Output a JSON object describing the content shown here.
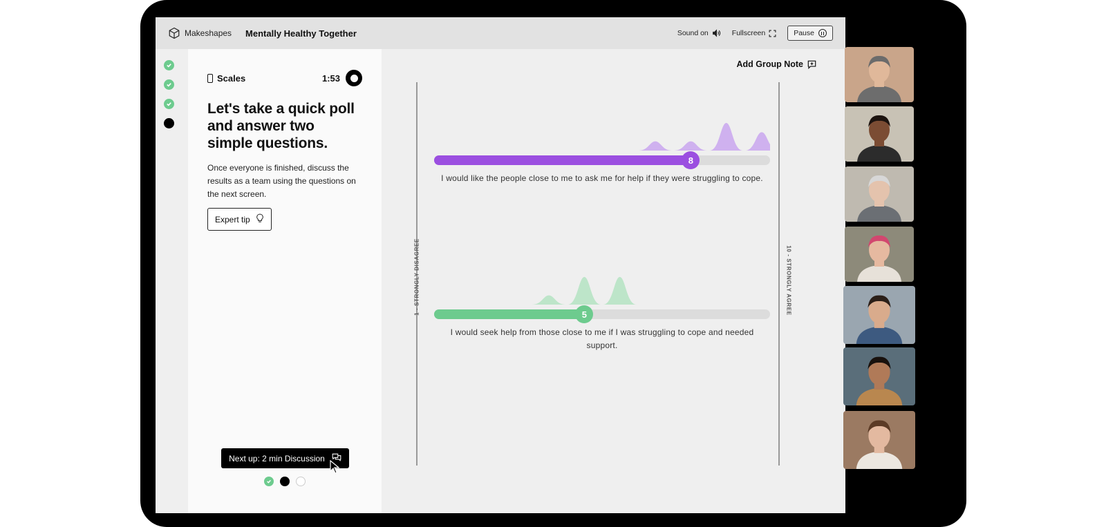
{
  "topbar": {
    "logo_text": "Makeshapes",
    "title": "Mentally Healthy Together",
    "sound_label": "Sound on",
    "fullscreen_label": "Fullscreen",
    "pause_label": "Pause"
  },
  "left_panel": {
    "activity_label": "Scales",
    "timer": "1:53",
    "heading": "Let's take a quick poll and answer two simple questions.",
    "description": "Once everyone is finished, discuss the results as a team using the questions on the next screen.",
    "expert_tip_label": "Expert tip",
    "next_up_label": "Next up: 2 min Discussion",
    "pager": [
      "done",
      "current",
      "empty"
    ]
  },
  "steps": [
    "done",
    "done",
    "done",
    "current"
  ],
  "main": {
    "add_note_label": "Add Group Note",
    "left_axis_label": "1 - STRONGLY DISAGREE",
    "right_axis_label": "10 - STRONGLY AGREE",
    "scale_min": 1,
    "scale_max": 10,
    "questions": [
      {
        "text": "I would like the people close to me to ask me for help if they were struggling to cope.",
        "value": 8,
        "value_label": "8",
        "color": "#9b4fe0",
        "dist_color": "#c9a6ee",
        "distribution": [
          0,
          0,
          0,
          0,
          0,
          0,
          1,
          1,
          3,
          2
        ]
      },
      {
        "text": "I would seek help from those close to me if I was struggling to cope and needed support.",
        "value": 5,
        "value_label": "5",
        "color": "#6dcb8e",
        "dist_color": "#b4e3c2",
        "distribution": [
          0,
          0,
          0,
          1,
          3,
          3,
          0,
          0,
          0,
          0
        ]
      }
    ]
  },
  "participants": [
    {
      "name": "participant-1",
      "bg": "#c9a58a",
      "skin": "#e0b89a",
      "hair": "#6b6b6b",
      "shirt": "#6d6d6d"
    },
    {
      "name": "participant-2",
      "bg": "#c8c2b5",
      "skin": "#7b4c33",
      "hair": "#1c130f",
      "shirt": "#2c2c2c"
    },
    {
      "name": "participant-3",
      "bg": "#bfbab0",
      "skin": "#e4c3ad",
      "hair": "#d7d7d7",
      "shirt": "#6b6f74"
    },
    {
      "name": "participant-4",
      "bg": "#8d8a7a",
      "skin": "#e6b9a0",
      "hair": "#d2476f",
      "shirt": "#e7e1d9"
    },
    {
      "name": "participant-5",
      "bg": "#9aa6b0",
      "skin": "#d9ab8c",
      "hair": "#2b1f18",
      "shirt": "#3d5a80"
    },
    {
      "name": "participant-6",
      "bg": "#5a6e7a",
      "skin": "#b07a58",
      "hair": "#18110d",
      "shirt": "#b9874f"
    },
    {
      "name": "participant-7",
      "bg": "#9b7a62",
      "skin": "#e3b9a0",
      "hair": "#5c3b26",
      "shirt": "#ece7e0"
    }
  ]
}
